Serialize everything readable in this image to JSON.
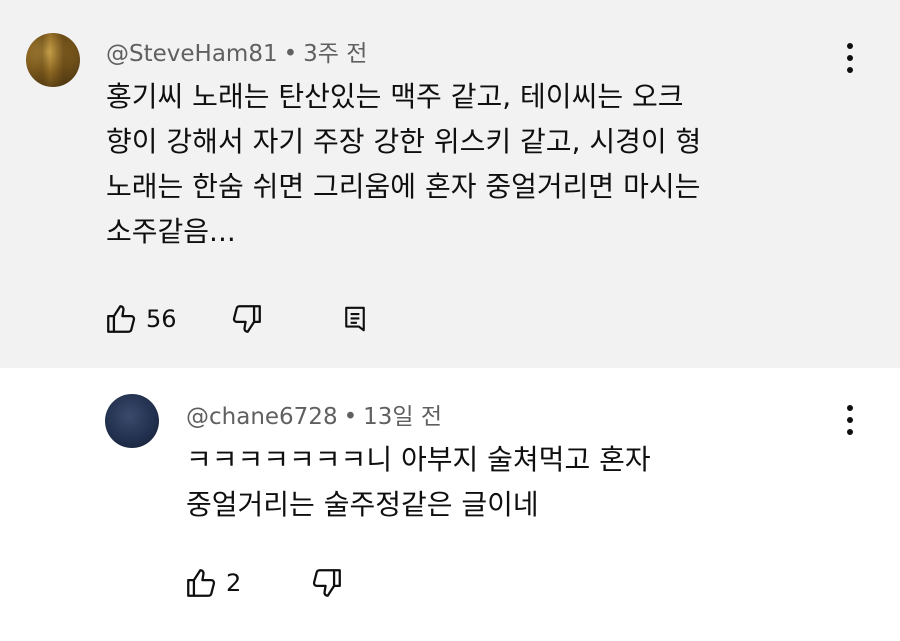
{
  "comments": [
    {
      "author": "@SteveHam81",
      "time": "3주 전",
      "text_lines": [
        "홍기씨 노래는 탄산있는 맥주 같고, 테이씨는 오크",
        "향이 강해서 자기 주장 강한 위스키 같고, 시경이 형",
        "노래는 한숨 쉬면 그리움에 혼자 중얼거리면 마시는",
        "소주같음..."
      ],
      "likes": "56",
      "icons": [
        "thumb-up-icon",
        "thumb-down-icon",
        "reply-icon",
        "more-vert-icon"
      ]
    },
    {
      "author": "@chane6728",
      "time": "13일 전",
      "text_lines": [
        "ㅋㅋㅋㅋㅋㅋㅋ니 아부지 술쳐먹고 혼자",
        "중얼거리는 술주정같은 글이네"
      ],
      "likes": "2",
      "icons": [
        "thumb-up-icon",
        "thumb-down-icon",
        "more-vert-icon"
      ]
    }
  ],
  "colors": {
    "highlight_bg": "#f2f2f2",
    "text": "#0f0f0f",
    "meta": "#606060"
  }
}
